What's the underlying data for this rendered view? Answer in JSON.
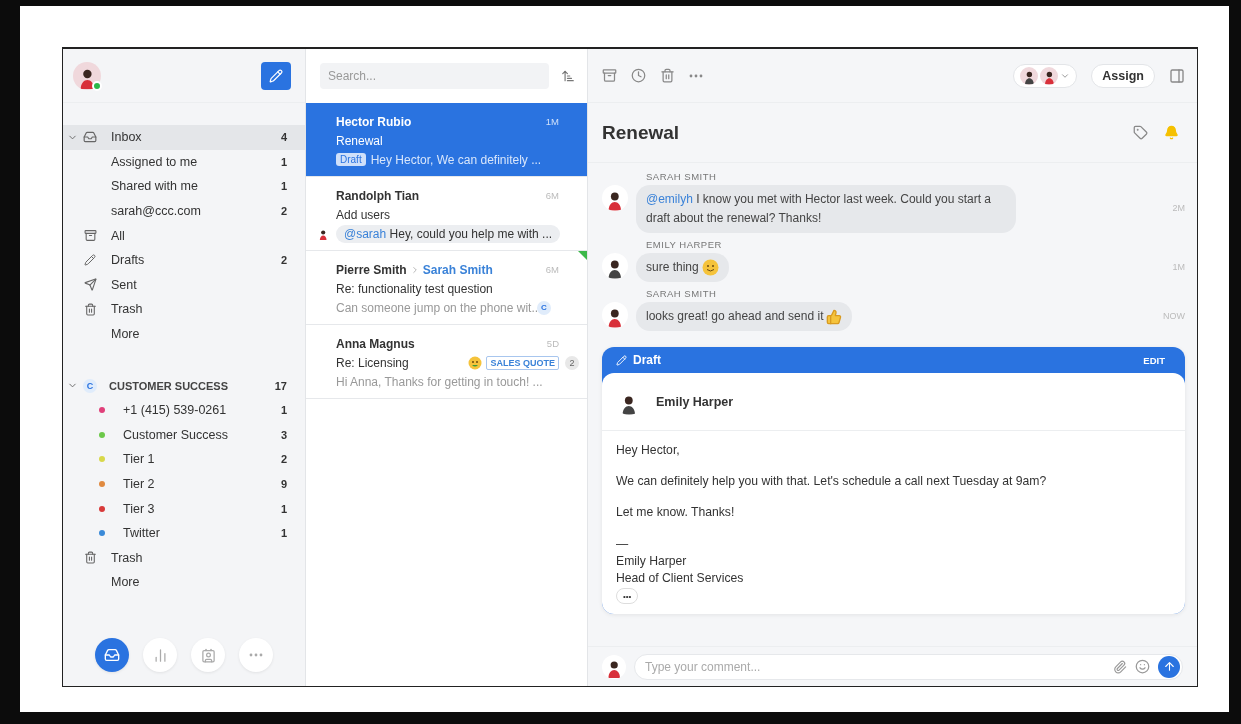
{
  "sidebar": {
    "compose_online": true,
    "inbox": {
      "label": "Inbox",
      "count": "4",
      "expanded": true,
      "selected": true,
      "items": [
        {
          "kind": "sub",
          "label": "Assigned to me",
          "count": "1"
        },
        {
          "kind": "sub",
          "label": "Shared with me",
          "count": "1"
        },
        {
          "kind": "sub",
          "label": "sarah@ccc.com",
          "count": "2"
        },
        {
          "kind": "archive",
          "label": "All"
        },
        {
          "kind": "drafts",
          "label": "Drafts",
          "count": "2"
        },
        {
          "kind": "sent",
          "label": "Sent"
        },
        {
          "kind": "trash",
          "label": "Trash"
        },
        {
          "kind": "sub",
          "label": "More"
        }
      ]
    },
    "team": {
      "badge": "C",
      "label": "CUSTOMER SUCCESS",
      "count": "17",
      "expanded": true,
      "items": [
        {
          "kind": "tag",
          "label": "+1 (415) 539-0261",
          "count": "1",
          "color": "#e0407a"
        },
        {
          "kind": "tag",
          "label": "Customer Success",
          "count": "3",
          "color": "#6cc84a"
        },
        {
          "kind": "tag",
          "label": "Tier 1",
          "count": "2",
          "color": "#d8d84a"
        },
        {
          "kind": "tag",
          "label": "Tier 2",
          "count": "9",
          "color": "#e08a40"
        },
        {
          "kind": "tag",
          "label": "Tier 3",
          "count": "1",
          "color": "#d83a3a"
        },
        {
          "kind": "tag",
          "label": "Twitter",
          "count": "1",
          "color": "#3a8ad8"
        },
        {
          "kind": "trash",
          "label": "Trash"
        },
        {
          "kind": "sub",
          "label": "More"
        }
      ]
    },
    "bottom_nav": [
      {
        "kind": "inbox",
        "selected": true
      },
      {
        "kind": "analytics",
        "selected": false
      },
      {
        "kind": "contacts",
        "selected": false
      },
      {
        "kind": "more",
        "selected": false
      }
    ]
  },
  "conversations": {
    "search": {
      "placeholder": "Search..."
    },
    "items": [
      {
        "name": "Hector Rubio",
        "time": "1M",
        "subject": "Renewal",
        "preview": "Hey Hector, We can definitely ...",
        "tag": "Draft",
        "selected": true,
        "flag": false
      },
      {
        "name": "Randolph Tian",
        "time": "6M",
        "subject": "Add users",
        "preview": "Hey, could you help me with ...",
        "mention": "@sarah",
        "selected": false,
        "flag": false
      },
      {
        "name": "Pierre Smith",
        "to": "Sarah Smith",
        "time": "6M",
        "subject": "Re: functionality test question",
        "preview": "Can someone jump on the phone wit...",
        "selected": false,
        "flag": true,
        "badges": [
          {
            "kind": "team",
            "text": "C"
          }
        ]
      },
      {
        "name": "Anna Magnus",
        "time": "5D",
        "subject": "Re: Licensing",
        "preview": "Hi Anna, Thanks for getting in touch! ...",
        "selected": false,
        "flag": false,
        "badges": [
          {
            "kind": "emoji"
          },
          {
            "kind": "label",
            "text": "SALES QUOTE"
          },
          {
            "kind": "count",
            "text": "2"
          }
        ]
      }
    ]
  },
  "thread": {
    "assign": "Assign",
    "title": "Renewal",
    "bell_on": true,
    "messages": [
      {
        "kind": "text",
        "author": "SARAH SMITH",
        "mention": "@emilyh",
        "text": "I know you met with Hector last week. Could you start a draft about the renewal? Thanks!",
        "time": "2M"
      },
      {
        "kind": "smile",
        "author": "EMILY HARPER",
        "text": "sure thing",
        "time": "1M"
      },
      {
        "kind": "thumbs",
        "author": "SARAH SMITH",
        "text": "looks great! go ahead and send it",
        "time": "NOW"
      }
    ],
    "draft": {
      "label": "Draft",
      "edit": "EDIT",
      "from": "Emily Harper",
      "body": [
        "Hey Hector,",
        "We can definitely help you with that. Let's schedule a call next Tuesday at 9am?",
        "Let me know. Thanks!"
      ],
      "signature": [
        "—",
        "Emily Harper",
        "Head of Client Services"
      ],
      "more": "•••"
    },
    "comment": {
      "placeholder": "Type your comment..."
    }
  }
}
